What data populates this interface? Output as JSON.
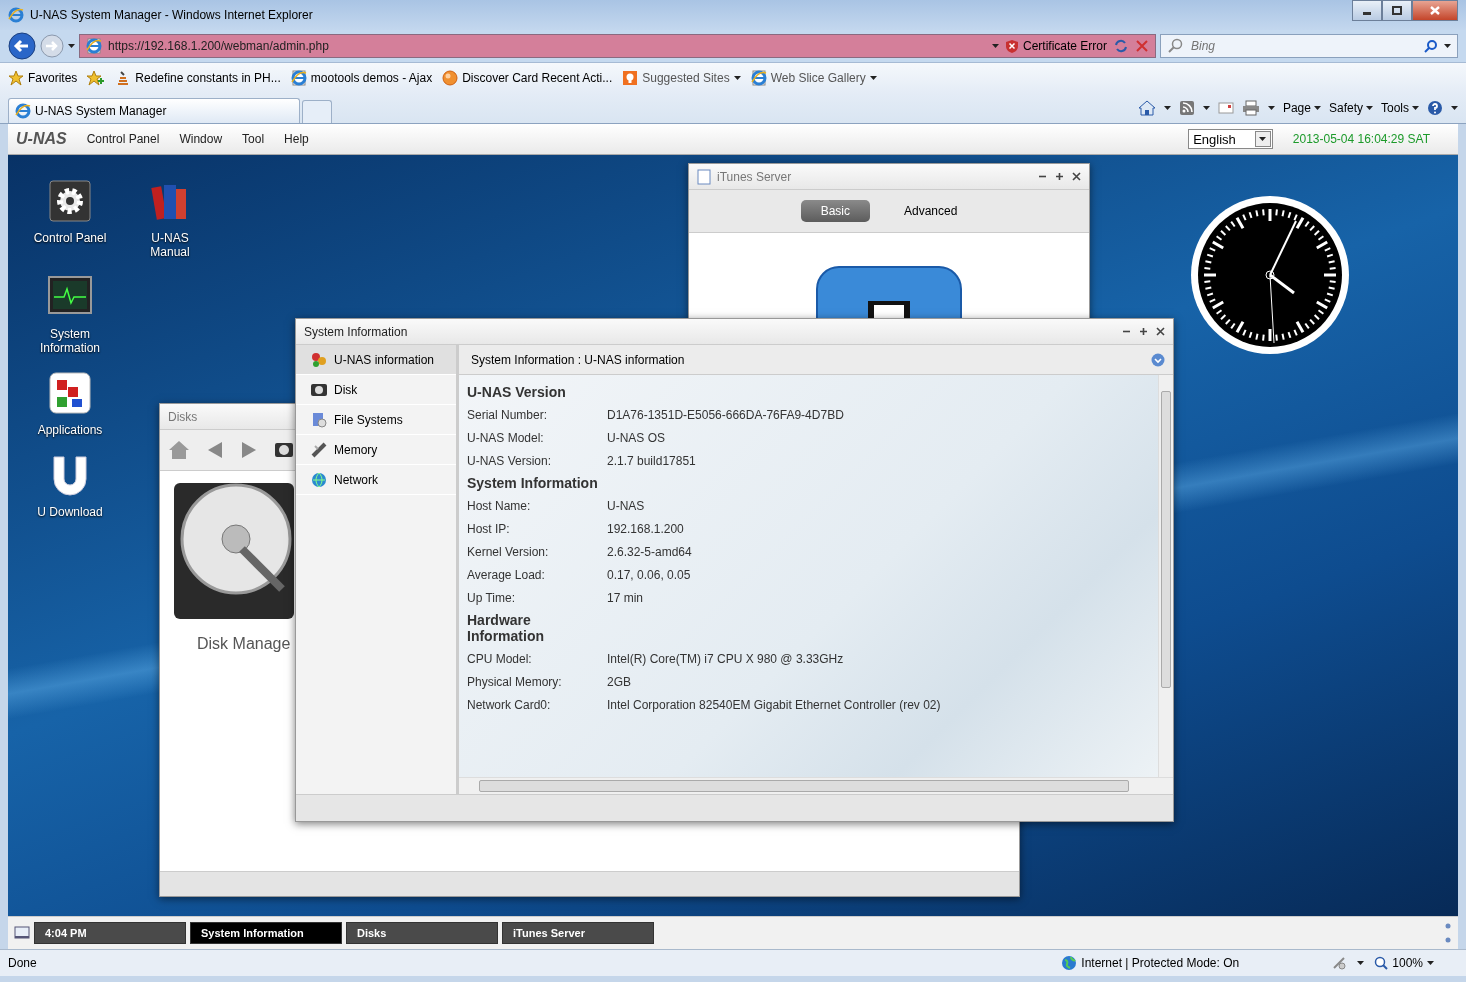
{
  "browser": {
    "title": "U-NAS System Manager - Windows Internet Explorer",
    "url": "https://192.168.1.200/webman/admin.php",
    "security": "Certificate Error",
    "search_placeholder": "Bing",
    "favorites_label": "Favorites",
    "favorites": [
      {
        "label": "Redefine constants in PH...",
        "kind": "feed",
        "dropdown": false
      },
      {
        "label": "mootools demos - Ajax",
        "kind": "page",
        "dropdown": false
      },
      {
        "label": "Discover Card Recent Acti...",
        "kind": "orb",
        "dropdown": false
      },
      {
        "label": "Suggested Sites",
        "kind": "bulb",
        "dropdown": true
      },
      {
        "label": "Web Slice Gallery",
        "kind": "page",
        "dropdown": true
      }
    ],
    "tab": "U-NAS System Manager",
    "commands": [
      "Page",
      "Safety",
      "Tools"
    ]
  },
  "app": {
    "logo": "U-NAS",
    "menu": [
      "Control Panel",
      "Window",
      "Tool",
      "Help"
    ],
    "language": "English",
    "datetime": "2013-05-04 16:04:29 SAT"
  },
  "desktop_icons": [
    {
      "label": "Control Panel",
      "kind": "gear"
    },
    {
      "label": "U-NAS Manual",
      "kind": "books"
    },
    {
      "label": "System Information",
      "kind": "monitor"
    },
    {
      "label": "Applications",
      "kind": "blocks"
    },
    {
      "label": "U Download",
      "kind": "letter"
    }
  ],
  "itunes_window": {
    "title": "iTunes Server",
    "tabs": [
      {
        "label": "Basic",
        "selected": true
      },
      {
        "label": "Advanced",
        "selected": false
      }
    ]
  },
  "disks_window": {
    "title": "Disks",
    "caption": "Disk Manage"
  },
  "sysinfo_window": {
    "title": "System Information",
    "header": "System Information : U-NAS information",
    "nav": [
      {
        "label": "U-NAS information",
        "kind": "info",
        "selected": true
      },
      {
        "label": "Disk",
        "kind": "disk",
        "selected": false
      },
      {
        "label": "File Systems",
        "kind": "fs",
        "selected": false
      },
      {
        "label": "Memory",
        "kind": "memory",
        "selected": false
      },
      {
        "label": "Network",
        "kind": "network",
        "selected": false
      }
    ],
    "sections": [
      {
        "heading": "U-NAS Version",
        "rows": [
          {
            "label": "Serial Number:",
            "value": "D1A76-1351D-E5056-666DA-76FA9-4D7BD"
          },
          {
            "label": "U-NAS Model:",
            "value": "U-NAS OS"
          },
          {
            "label": "U-NAS Version:",
            "value": "2.1.7 build17851"
          }
        ]
      },
      {
        "heading": "System Information",
        "rows": [
          {
            "label": "Host Name:",
            "value": "U-NAS"
          },
          {
            "label": "Host IP:",
            "value": "192.168.1.200"
          },
          {
            "label": "Kernel Version:",
            "value": "2.6.32-5-amd64"
          },
          {
            "label": "Average Load:",
            "value": "0.17, 0.06, 0.05"
          },
          {
            "label": "Up Time:",
            "value": "17 min"
          }
        ]
      },
      {
        "heading": "Hardware Information",
        "rows": [
          {
            "label": "CPU Model:",
            "value": "Intel(R) Core(TM) i7 CPU X 980 @ 3.33GHz"
          },
          {
            "label": "Physical Memory:",
            "value": "2GB"
          },
          {
            "label": "Network Card0:",
            "value": "Intel Corporation 82540EM Gigabit Ethernet Controller (rev 02)"
          }
        ]
      }
    ]
  },
  "taskbar": [
    {
      "label": "4:04 PM",
      "selected": false
    },
    {
      "label": "System Information",
      "selected": true
    },
    {
      "label": "Disks",
      "selected": false
    },
    {
      "label": "iTunes Server",
      "selected": false
    }
  ],
  "status_bar": {
    "text": "Done",
    "zone": "Internet | Protected Mode: On",
    "zoom": "100%"
  }
}
